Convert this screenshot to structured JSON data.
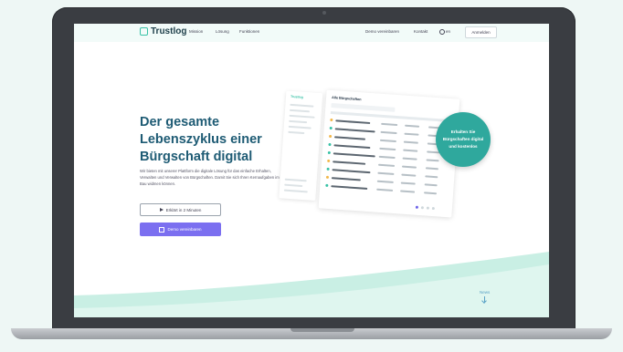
{
  "nav": {
    "brand": "Trustlog",
    "links": [
      "Mission",
      "Lösung",
      "Funktionen"
    ],
    "demo_link": "Demo vereinbaren",
    "contact_link": "Kontakt",
    "language": "en",
    "login_button": "Anmelden"
  },
  "hero": {
    "headline": "Der gesamte Lebenszyklus einer Bürgschaft digital",
    "subtext": "Wir bieten mit unserer Plattform die digitale Lösung für das einfache Erhalten, Verwalten und Verwalten von Bürgschaften. Damit Sie sich Ihren Kernaufgaben im Bau widmen können.",
    "video_button": "Erklärt in 2 Minuten",
    "demo_button": "Demo vereinbaren"
  },
  "mockup": {
    "sidebar_title": "Trustlog",
    "title": "Alle Bürgschaften"
  },
  "badge": {
    "line1": "Erhalten Sie",
    "line2": "Bürgschaften digital",
    "line3": "und kostenlos"
  },
  "footer": {
    "news_label": "News"
  },
  "colors": {
    "accent_teal": "#2fa89d",
    "primary_purple": "#7b6ff0",
    "headline_blue": "#1e5b74"
  }
}
